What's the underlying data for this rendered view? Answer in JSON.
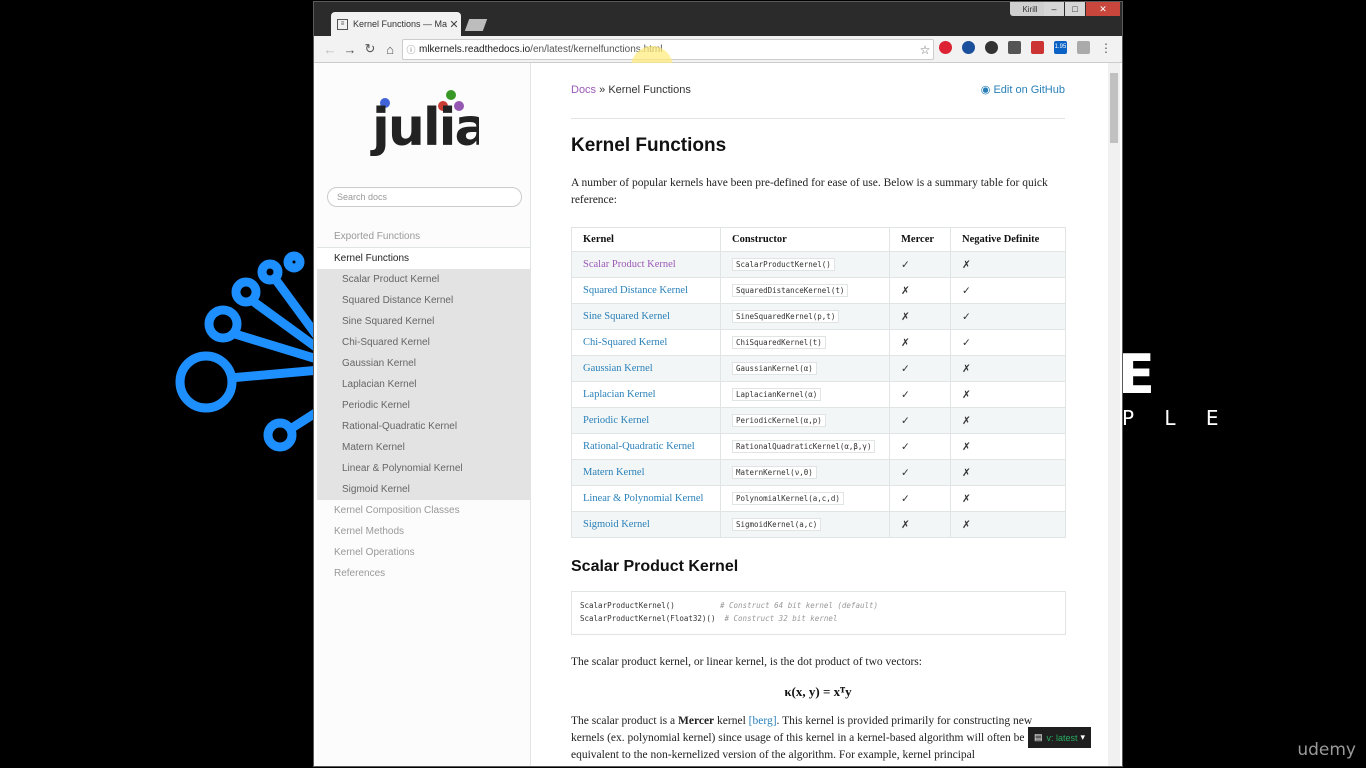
{
  "browser": {
    "tab_title": "Kernel Functions — Mac",
    "user_badge": "Kirill",
    "url_host": "mlkernels.readthedocs.io",
    "url_path": "/en/latest/kernelfunctions.html",
    "extension_badge": "1.95",
    "window_buttons": {
      "minimize": "–",
      "maximize": "□",
      "close": "✕"
    }
  },
  "background": {
    "brand_big": "E",
    "brand_small": "P L E",
    "watermark": "udemy"
  },
  "sidebar": {
    "logo_text": "julia",
    "search_placeholder": "Search docs",
    "items": [
      {
        "label": "Exported Functions",
        "kind": "top"
      },
      {
        "label": "Kernel Functions",
        "kind": "current"
      },
      {
        "label": "Scalar Product Kernel",
        "kind": "sub"
      },
      {
        "label": "Squared Distance Kernel",
        "kind": "sub"
      },
      {
        "label": "Sine Squared Kernel",
        "kind": "sub"
      },
      {
        "label": "Chi-Squared Kernel",
        "kind": "sub"
      },
      {
        "label": "Gaussian Kernel",
        "kind": "sub"
      },
      {
        "label": "Laplacian Kernel",
        "kind": "sub"
      },
      {
        "label": "Periodic Kernel",
        "kind": "sub"
      },
      {
        "label": "Rational-Quadratic Kernel",
        "kind": "sub"
      },
      {
        "label": "Matern Kernel",
        "kind": "sub"
      },
      {
        "label": "Linear & Polynomial Kernel",
        "kind": "sub"
      },
      {
        "label": "Sigmoid Kernel",
        "kind": "sub"
      },
      {
        "label": "Kernel Composition Classes",
        "kind": "top"
      },
      {
        "label": "Kernel Methods",
        "kind": "top"
      },
      {
        "label": "Kernel Operations",
        "kind": "top"
      },
      {
        "label": "References",
        "kind": "top"
      }
    ]
  },
  "content": {
    "breadcrumb_docs": "Docs",
    "breadcrumb_sep": "»",
    "breadcrumb_current": "Kernel Functions",
    "edit_link": "Edit on GitHub",
    "title": "Kernel Functions",
    "intro": "A number of popular kernels have been pre-defined for ease of use. Below is a summary table for quick reference:",
    "table": {
      "headers": [
        "Kernel",
        "Constructor",
        "Mercer",
        "Negative Definite"
      ],
      "rows": [
        {
          "kernel": "Scalar Product Kernel",
          "constructor": "ScalarProductKernel()",
          "mercer": "✓",
          "negdef": "✗",
          "visited": true
        },
        {
          "kernel": "Squared Distance Kernel",
          "constructor": "SquaredDistanceKernel(t)",
          "mercer": "✗",
          "negdef": "✓"
        },
        {
          "kernel": "Sine Squared Kernel",
          "constructor": "SineSquaredKernel(p,t)",
          "mercer": "✗",
          "negdef": "✓"
        },
        {
          "kernel": "Chi-Squared Kernel",
          "constructor": "ChiSquaredKernel(t)",
          "mercer": "✗",
          "negdef": "✓"
        },
        {
          "kernel": "Gaussian Kernel",
          "constructor": "GaussianKernel(α)",
          "mercer": "✓",
          "negdef": "✗"
        },
        {
          "kernel": "Laplacian Kernel",
          "constructor": "LaplacianKernel(α)",
          "mercer": "✓",
          "negdef": "✗"
        },
        {
          "kernel": "Periodic Kernel",
          "constructor": "PeriodicKernel(α,p)",
          "mercer": "✓",
          "negdef": "✗"
        },
        {
          "kernel": "Rational-Quadratic Kernel",
          "constructor": "RationalQuadraticKernel(α,β,γ)",
          "mercer": "✓",
          "negdef": "✗"
        },
        {
          "kernel": "Matern Kernel",
          "constructor": "MaternKernel(ν,θ)",
          "mercer": "✓",
          "negdef": "✗"
        },
        {
          "kernel": "Linear & Polynomial Kernel",
          "constructor": "PolynomialKernel(a,c,d)",
          "mercer": "✓",
          "negdef": "✗"
        },
        {
          "kernel": "Sigmoid Kernel",
          "constructor": "SigmoidKernel(a,c)",
          "mercer": "✗",
          "negdef": "✗"
        }
      ]
    },
    "section2_title": "Scalar Product Kernel",
    "code_lines": [
      {
        "code": "ScalarProductKernel()         ",
        "comment": "# Construct 64 bit kernel (default)"
      },
      {
        "code": "ScalarProductKernel(Float32)()",
        "comment": " # Construct 32 bit kernel"
      }
    ],
    "para1": "The scalar product kernel, or linear kernel, is the dot product of two vectors:",
    "formula": "κ(x, y) = xᵀy",
    "para2_pre": "The scalar product is a ",
    "para2_bold": "Mercer",
    "para2_mid": " kernel ",
    "para2_link": "[berg]",
    "para2_post": ". This kernel is provided primarily for constructing new kernels (ex. polynomial kernel) since usage of this kernel in a kernel-based algorithm will often be equivalent to the non-kernelized version of the algorithm. For example, kernel principal",
    "version_label": "v: latest"
  },
  "colors": {
    "link": "#2980b9",
    "visited": "#9b59b6",
    "version_green": "#27ae60",
    "bg_blue": "#1e8fff"
  }
}
